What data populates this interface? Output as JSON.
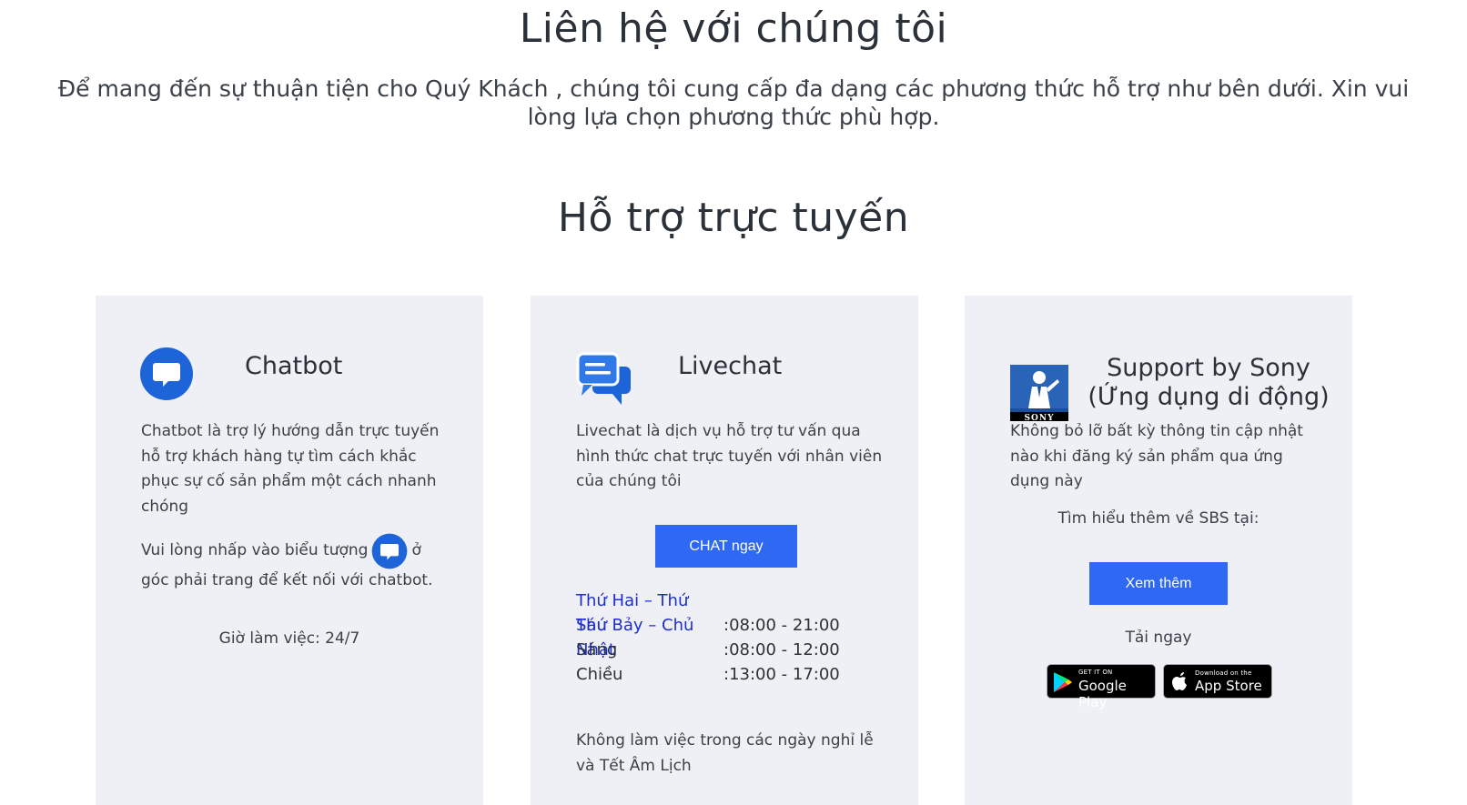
{
  "header": {
    "title": "Liên hệ với chúng tôi",
    "intro_line1": "Để mang đến sự thuận tiện cho Quý Khách , chúng tôi cung cấp đa dạng các phương thức hỗ trợ như bên dưới. Xin vui",
    "intro_line2": "lòng lựa chọn phương thức phù hợp."
  },
  "section": {
    "title": "Hỗ trợ trực tuyến"
  },
  "chatbot": {
    "title": "Chatbot",
    "description": [
      "Chatbot là trợ lý hướng dẫn trực tuyến",
      "hỗ trợ khách hàng tự tìm cách khắc",
      "phục sự cố sản phẩm một cách nhanh",
      "chóng"
    ],
    "instruction_before_icon": "Vui lòng nhấp vào biểu tượng",
    "instruction_after_icon": "ở",
    "instruction_line2": "góc phải trang để kết nối với chatbot.",
    "hours": "Giờ làm việc: 24/7",
    "icon": "chat-bubble-icon"
  },
  "livechat": {
    "title": "Livechat",
    "description": [
      "Livechat là dịch vụ hỗ trợ tư vấn qua",
      "hình thức chat trực tuyến với nhân viên",
      "của chúng tôi"
    ],
    "button_label": "CHAT ngay",
    "hours": [
      {
        "label": "Thứ Hai – Thứ Sáu",
        "value": ":08:00 - 21:00"
      },
      {
        "label": "Thứ Bảy – Chủ Nhật",
        "value": ""
      },
      {
        "label": "Sáng",
        "value": ":08:00 - 12:00"
      },
      {
        "label": "Chiều",
        "value": ":13:00 - 17:00"
      }
    ],
    "note": [
      "Không làm việc trong các ngày nghỉ lễ",
      "và Tết Âm Lịch"
    ],
    "icon": "livechat-bubbles-icon"
  },
  "sony": {
    "title_line1": "Support by Sony",
    "title_line2": "(Ứng dụng di động)",
    "logo_text": "SONY",
    "description": [
      "Không bỏ lỡ bất kỳ thông tin cập nhật",
      "nào khi đăng ký sản phẩm qua ứng",
      "dụng này"
    ],
    "learn_more": "Tìm hiểu thêm về SBS tại:",
    "button_label": "Xem thêm",
    "download_label": "Tải ngay",
    "google_play": {
      "small": "GET IT ON",
      "big": "Google Play"
    },
    "app_store": {
      "small": "Download on the",
      "big": "App Store"
    }
  },
  "colors": {
    "accent": "#2f68f2",
    "link": "#1d2ecf",
    "card_bg": "#eef0f5",
    "chat_icon": "#1d64d8"
  }
}
